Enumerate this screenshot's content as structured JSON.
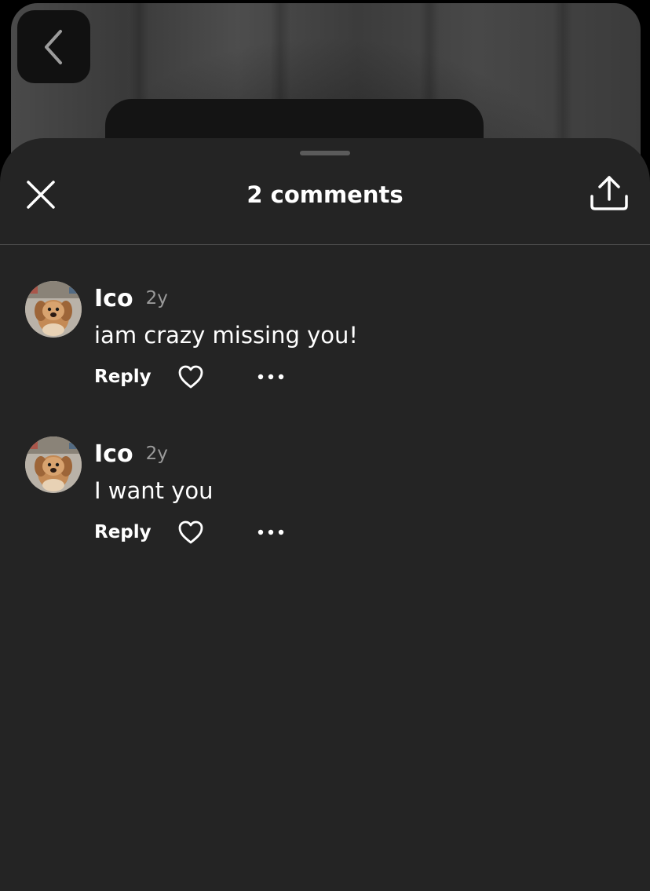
{
  "header": {
    "back_icon": "chevron-left-icon"
  },
  "sheet": {
    "title": "2 comments",
    "close_icon": "close-icon",
    "share_icon": "share-icon"
  },
  "comments": [
    {
      "author": "Ico",
      "age": "2y",
      "text": "iam crazy missing you!",
      "reply_label": "Reply",
      "like_icon": "heart-outline-icon",
      "more_icon": "more-horizontal-icon"
    },
    {
      "author": "Ico",
      "age": "2y",
      "text": "I want you",
      "reply_label": "Reply",
      "like_icon": "heart-outline-icon",
      "more_icon": "more-horizontal-icon"
    }
  ],
  "colors": {
    "sheet_background": "#242424",
    "text_primary": "#ffffff",
    "text_secondary": "#9a9a9a",
    "divider": "#4a4a4a"
  }
}
